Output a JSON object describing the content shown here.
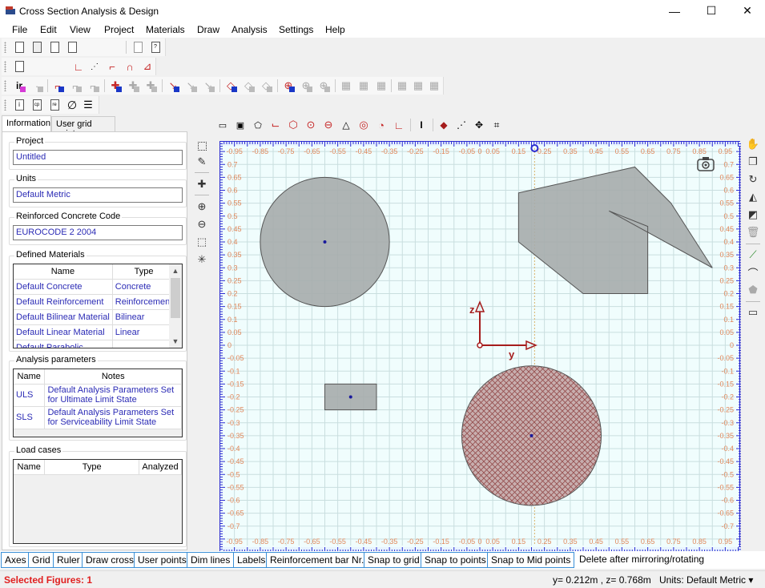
{
  "window": {
    "title": "Cross Section Analysis & Design",
    "minimize": "—",
    "maximize": "☐",
    "close": "✕"
  },
  "menu": [
    "File",
    "Edit",
    "View",
    "Project",
    "Materials",
    "Draw",
    "Analysis",
    "Settings",
    "Help"
  ],
  "toolbars": {
    "row1": [
      "new-file-icon",
      "open-file-icon",
      "save-icon",
      "save-as-icon",
      "copy-icon",
      "help-file-icon"
    ],
    "row2": [
      "section-icon",
      "line-icon",
      "polyline-icon",
      "curve-icon",
      "arch-icon",
      "chart-icon"
    ],
    "row3": [
      "ir-icon",
      "ir-r-icon",
      "moment-curvature-l-icon",
      "moment-curvature-r1-icon",
      "moment-curvature-r2-icon",
      "interaction-l-icon",
      "interaction-r1-icon",
      "interaction-r2-icon",
      "stress-l-icon",
      "stress-r1-icon",
      "stress-r2-icon",
      "diagram-l-icon",
      "diagram-r1-icon",
      "diagram-r2-icon",
      "axial-l-icon",
      "axial-r1-icon",
      "axial-r2-icon",
      "query-l-icon",
      "query-r1-icon",
      "query-r2-icon",
      "play-l-icon",
      "play-r1-icon",
      "play-r2-icon"
    ],
    "row4": [
      "info-icon",
      "cp-icon",
      "re-icon",
      "empty-set-icon",
      "list-icon"
    ]
  },
  "left_panel": {
    "tabs": [
      "Information",
      "User grid points"
    ],
    "active_tab": "Information",
    "project": {
      "label": "Project",
      "value": "Untitled"
    },
    "units": {
      "label": "Units",
      "value": "Default Metric"
    },
    "code": {
      "label": "Reinforced Concrete Code",
      "value": "EUROCODE 2 2004"
    },
    "materials": {
      "label": "Defined Materials",
      "columns": [
        "Name",
        "Type"
      ],
      "rows": [
        [
          "Default Concrete",
          "Concrete"
        ],
        [
          "Default Reinforcement",
          "Reinforcement"
        ],
        [
          "Default Bilinear Material",
          "Bilinear"
        ],
        [
          "Default Linear Material",
          "Linear"
        ],
        [
          "Default Parabolic",
          ""
        ]
      ]
    },
    "analysis": {
      "label": "Analysis parameters",
      "columns": [
        "Name",
        "Notes"
      ],
      "rows": [
        [
          "ULS",
          "Default Analysis Parameters Set for Ultimate Limit State"
        ],
        [
          "SLS",
          "Default Analysis Parameters Set for Serviceability Limit State"
        ]
      ]
    },
    "loadcases": {
      "label": "Load cases",
      "columns": [
        "Name",
        "Type",
        "Analyzed"
      ],
      "rows": []
    }
  },
  "draw_tools": [
    "rectangle-tool",
    "box-section-tool",
    "polygon-tool",
    "l-shape-tool",
    "hexagon-tool",
    "circle-tool",
    "circle-center-tool",
    "triangle-tool",
    "ring-tool",
    "arc-section-tool",
    "corner-tool",
    "i-beam-tool",
    "point-tool",
    "line-points-tool",
    "move-points-tool",
    "rect-points-tool"
  ],
  "side_tools": [
    "select-icon",
    "paint-icon",
    "pan-icon",
    "zoom-in-icon",
    "zoom-out-icon",
    "zoom-window-icon",
    "zoom-extents-icon"
  ],
  "right_tools": [
    "hand-icon",
    "copy-icon",
    "rotate-icon",
    "mirror-icon",
    "layer-icon",
    "delete-icon",
    "dimension-line-icon",
    "arc-dimension-icon",
    "point-label-icon",
    "comment-icon"
  ],
  "canvas": {
    "x_ticks": [
      "-0.95",
      "-0.85",
      "-0.75",
      "-0.65",
      "-0.55",
      "-0.45",
      "-0.35",
      "-0.25",
      "-0.15",
      "-0.05",
      "0",
      "0.05",
      "0.15",
      "0.25",
      "0.35",
      "0.45",
      "0.55",
      "0.65",
      "0.75",
      "0.85",
      "0.95"
    ],
    "y_ticks": [
      "0.7",
      "0.65",
      "0.6",
      "0.55",
      "0.5",
      "0.45",
      "0.4",
      "0.35",
      "0.3",
      "0.25",
      "0.2",
      "0.15",
      "0.1",
      "0.05",
      "0",
      "-0.05",
      "-0.1",
      "-0.15",
      "-0.2",
      "-0.25",
      "-0.3",
      "-0.35",
      "-0.4",
      "-0.45",
      "-0.5",
      "-0.55",
      "-0.6",
      "-0.65",
      "-0.7"
    ],
    "corner_label": "-0.95",
    "axis_labels": {
      "y": "y",
      "z": "z"
    },
    "guide_x": 0.212,
    "shapes": [
      {
        "type": "circle",
        "name": "concrete-circle-shape",
        "cy": -0.6,
        "cz": 0.4,
        "r": 0.25,
        "fill": "#a6acac",
        "hatched": false
      },
      {
        "type": "rect",
        "name": "rectangle-shape",
        "y0": -0.6,
        "z0": -0.25,
        "y1": -0.4,
        "z1": -0.15,
        "fill": "#a6acac"
      },
      {
        "type": "circle",
        "name": "selected-circle-shape",
        "cy": 0.2,
        "cz": -0.35,
        "r": 0.27,
        "fill": "#c4a6a6",
        "hatched": true
      },
      {
        "type": "polygon",
        "name": "polygon-shape",
        "points": [
          [
            0.15,
            0.59
          ],
          [
            0.6,
            0.69
          ],
          [
            0.74,
            0.55
          ],
          [
            0.9,
            0.3
          ],
          [
            0.5,
            0.52
          ],
          [
            0.65,
            0.46
          ],
          [
            0.65,
            0.2
          ],
          [
            0.4,
            0.2
          ],
          [
            0.15,
            0.4
          ]
        ],
        "fill": "#a6acac"
      }
    ],
    "colors": {
      "tick_label": "#e0875a",
      "ruler": "#2b2bd0",
      "grid": "#c9dedf",
      "axis": "#a51c1c"
    }
  },
  "toggles": [
    "Axes",
    "Grid",
    "Ruler",
    "Draw cross",
    "User points",
    "Dim lines",
    "Labels",
    "Reinforcement bar Nr.",
    "Snap to grid",
    "Snap to points",
    "Snap to Mid points",
    "Delete after mirroring/rotating"
  ],
  "status": {
    "selected": "Selected Figures: 1",
    "coords": "y= 0.212m , z= 0.768m",
    "units": "Units: Default Metric ▾"
  }
}
